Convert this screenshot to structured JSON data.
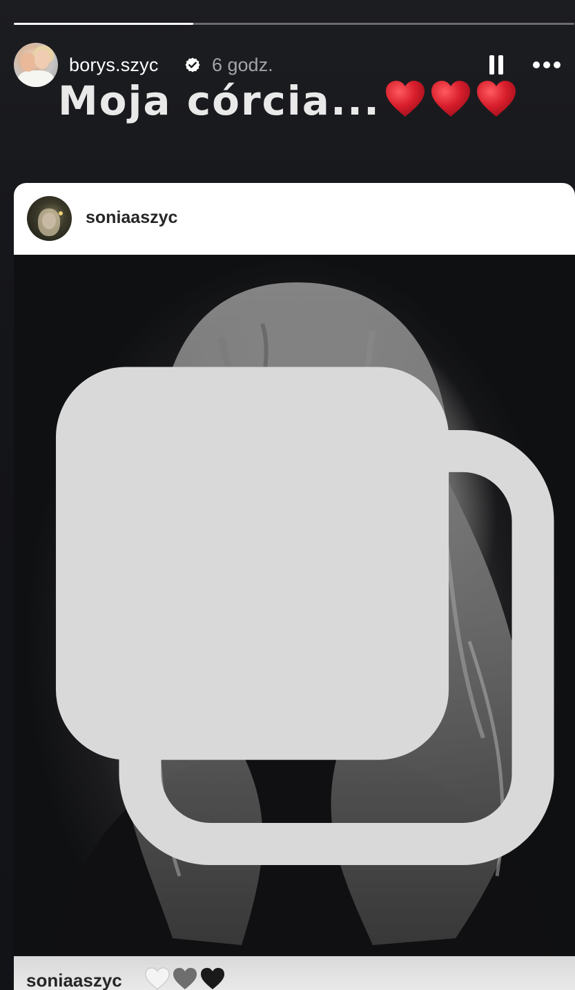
{
  "story": {
    "progress": 0.32,
    "username": "borys.szyc",
    "verified": true,
    "time": "6 godz.",
    "caption": "Moja córcia...",
    "caption_hearts": [
      "red-heart",
      "red-heart",
      "red-heart"
    ]
  },
  "post": {
    "username": "soniaaszyc",
    "footer_username": "soniaaszyc",
    "footer_hearts": [
      "white-heart",
      "grey-heart",
      "black-heart"
    ],
    "is_carousel": true
  },
  "colors": {
    "background": "#141519",
    "heart_red": "#d81e2c",
    "progress_track": "rgba(255,255,255,0.35)",
    "progress_fill": "#ffffff"
  }
}
